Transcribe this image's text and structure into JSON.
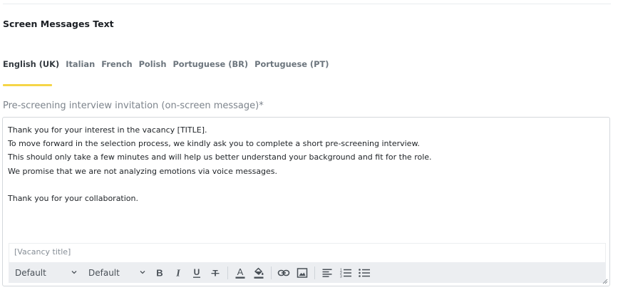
{
  "section": {
    "title": "Screen Messages Text"
  },
  "tabs": [
    {
      "label": "English (UK)",
      "active": true
    },
    {
      "label": "Italian",
      "active": false
    },
    {
      "label": "French",
      "active": false
    },
    {
      "label": "Polish",
      "active": false
    },
    {
      "label": "Portuguese (BR)",
      "active": false
    },
    {
      "label": "Portuguese (PT)",
      "active": false
    }
  ],
  "field": {
    "label": "Pre-screening interview invitation (on-screen message)*",
    "lines": [
      "Thank you for your interest in the vacancy [TITLE].",
      "To move forward in the selection process, we kindly ask you to complete a short pre-screening interview.",
      "This should only take a few minutes and will help us better understand your background and fit for the role.",
      "We promise that we are not analyzing emotions via voice messages.",
      "",
      "Thank you for your collaboration."
    ]
  },
  "variables": {
    "vacancy_title": "[Vacancy title]"
  },
  "toolbar": {
    "font_select": "Default",
    "size_select": "Default",
    "icons": [
      "bold-icon",
      "italic-icon",
      "underline-icon",
      "strikethrough-icon",
      "text-color-icon",
      "fill-color-icon",
      "link-icon",
      "image-icon",
      "align-left-icon",
      "ordered-list-icon",
      "bullet-list-icon"
    ]
  },
  "colors": {
    "tab_accent": "#f5d547",
    "toolbar_bg": "#eceef1",
    "text_color_bar": "#d3d7db"
  }
}
